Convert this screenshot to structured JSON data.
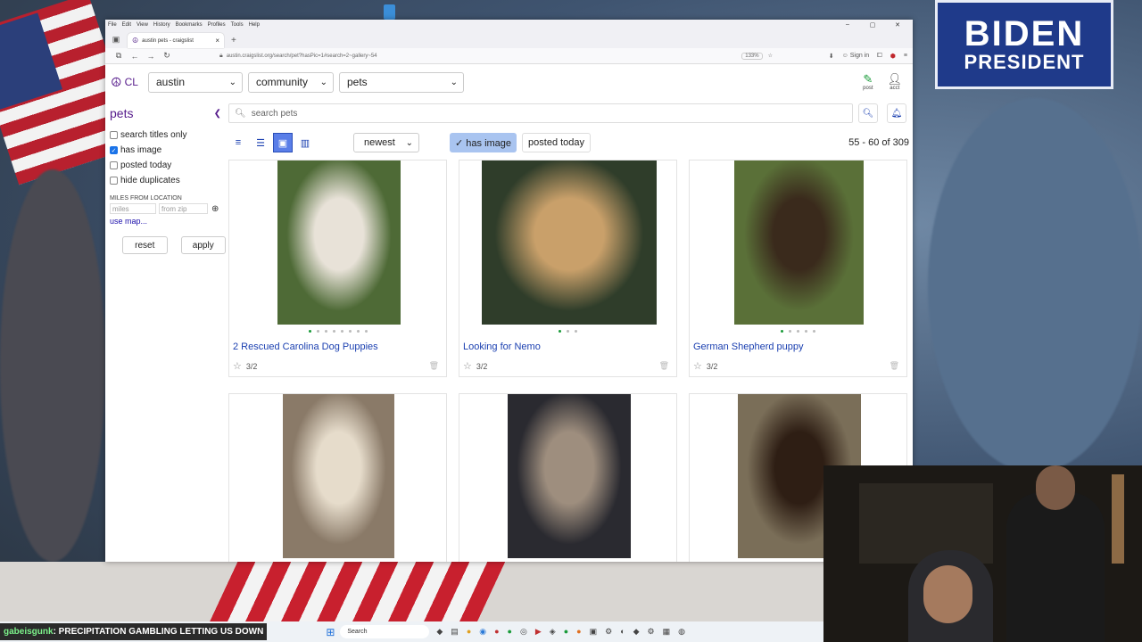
{
  "browser": {
    "menu": [
      "File",
      "Edit",
      "View",
      "History",
      "Bookmarks",
      "Profiles",
      "Tools",
      "Help"
    ],
    "tab_title": "austin pets - craigslist",
    "url": "austin.craigslist.org/search/pet?hasPic=1#search=2~gallery~54",
    "zoom": "133%",
    "sign_in": "Sign in"
  },
  "topbar": {
    "logo": "CL",
    "city": "austin",
    "category": "community",
    "subcategory": "pets",
    "post_label": "post",
    "acct_label": "acct"
  },
  "sidebar": {
    "title": "pets",
    "filters": [
      {
        "label": "search titles only",
        "checked": false
      },
      {
        "label": "has image",
        "checked": true
      },
      {
        "label": "posted today",
        "checked": false
      },
      {
        "label": "hide duplicates",
        "checked": false
      }
    ],
    "miles_label": "MILES FROM LOCATION",
    "miles_placeholder": "miles",
    "zip_placeholder": "from zip",
    "use_map": "use map...",
    "reset_label": "reset",
    "apply_label": "apply"
  },
  "search": {
    "placeholder": "search pets"
  },
  "toolbar": {
    "sort": "newest",
    "has_image_chip": "✓ has image",
    "posted_today_chip": "posted today",
    "result_count": "55 - 60 of 309"
  },
  "listings": [
    {
      "title": "2 Rescued Carolina Dog Puppies",
      "date": "3/2",
      "photo_colors": [
        "#4e6a36",
        "#e8e2d8"
      ],
      "dots": 8,
      "active_dot": 0
    },
    {
      "title": "Looking for Nemo",
      "date": "3/2",
      "photo_colors": [
        "#2f3d2a",
        "#c9a06a"
      ],
      "dots": 3,
      "active_dot": 0
    },
    {
      "title": "German Shepherd puppy",
      "date": "3/2",
      "photo_colors": [
        "#5a7038",
        "#3a2a1c"
      ],
      "dots": 5,
      "active_dot": 0
    },
    {
      "title": "",
      "date": "",
      "photo_colors": [
        "#8a7a68",
        "#e6dccb"
      ],
      "dots": 0,
      "active_dot": 0
    },
    {
      "title": "",
      "date": "",
      "photo_colors": [
        "#2a2a30",
        "#9e8e7e"
      ],
      "dots": 0,
      "active_dot": 0
    },
    {
      "title": "",
      "date": "",
      "photo_colors": [
        "#7a6e58",
        "#2e1e14"
      ],
      "dots": 0,
      "active_dot": 0
    }
  ],
  "stream": {
    "sign_line1": "BIDEN",
    "sign_line2": "PRESIDENT",
    "ticker_user": "gabeisgunk",
    "ticker_text": ": PRECIPITATION GAMBLING LETTING US DOWN",
    "taskbar_search": "Search"
  },
  "colors": {
    "cl_purple": "#551a8b",
    "link_blue": "#1a3fb0",
    "chip_blue": "#a9c4f0",
    "post_green": "#1a9b3a"
  }
}
